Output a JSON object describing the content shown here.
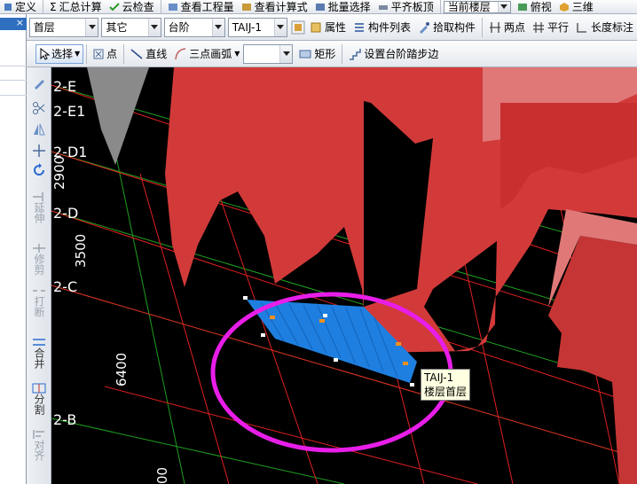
{
  "toolbar1": {
    "items": [
      "定义",
      "汇总计算",
      "云检查",
      "查看工程量",
      "查看计算式",
      "批量选择",
      "平齐板顶",
      "当前楼层",
      "俯视",
      "三维"
    ]
  },
  "toolbar2": {
    "floor": "首层",
    "category": "其它",
    "type": "台阶",
    "component": "TAIJ-1",
    "property": "属性",
    "component_list": "构件列表",
    "pick_component": "拾取构件",
    "two_point": "两点",
    "parallel": "平行",
    "length_dim": "长度标注"
  },
  "toolbar3": {
    "select": "选择",
    "point": "点",
    "line": "直线",
    "arc3": "三点画弧",
    "rect": "矩形",
    "set_step": "设置台阶踏步边"
  },
  "vtools": [
    "延伸",
    "修剪",
    "打断",
    "合并",
    "分割",
    "对齐"
  ],
  "axes": {
    "rows": [
      "2-E",
      "2-E1",
      "2-D1",
      "2-D",
      "2-C",
      "2-B"
    ],
    "dims": [
      "2900",
      "3500",
      "6400",
      "00"
    ]
  },
  "tooltip": {
    "name": "TAIJ-1",
    "floor": "楼层首层"
  },
  "colors": {
    "wall": "#d23a3a",
    "wall_light": "#e07878",
    "step": "#1e7fe0",
    "highlight_ring": "#e81ee8",
    "grid_red": "#e02020",
    "grid_green": "#20a020",
    "column_gray": "#8a8a8a"
  }
}
